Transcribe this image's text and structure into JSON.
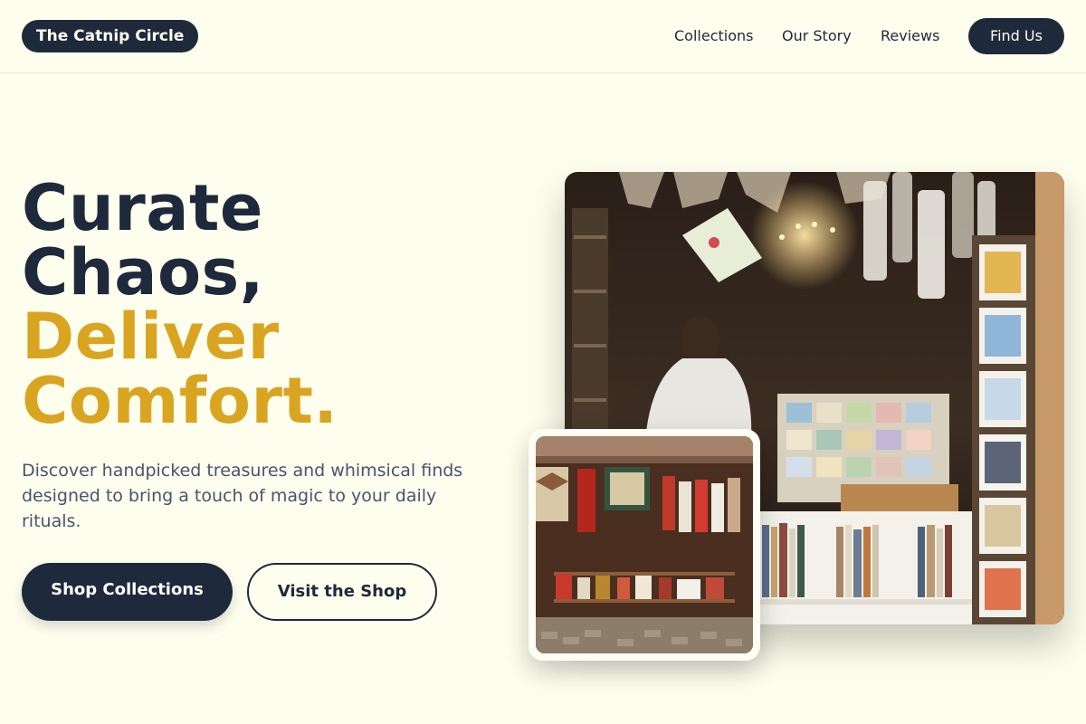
{
  "header": {
    "brand": "The Catnip Circle",
    "nav": [
      "Collections",
      "Our Story",
      "Reviews"
    ],
    "cta": "Find Us"
  },
  "hero": {
    "headline_dark": [
      "Curate",
      "Chaos,"
    ],
    "headline_gold": [
      "Deliver",
      "Comfort."
    ],
    "description": "Discover handpicked treasures and whimsical finds designed to bring a touch of magic to your daily rituals.",
    "primary_button": "Shop Collections",
    "secondary_button": "Visit the Shop"
  },
  "images": {
    "main": "bookshop-interior-photo",
    "inset": "market-stall-photo"
  },
  "colors": {
    "background": "#fefeee",
    "navy": "#1e293b",
    "gold": "#d9a521",
    "body_text": "#475569"
  }
}
